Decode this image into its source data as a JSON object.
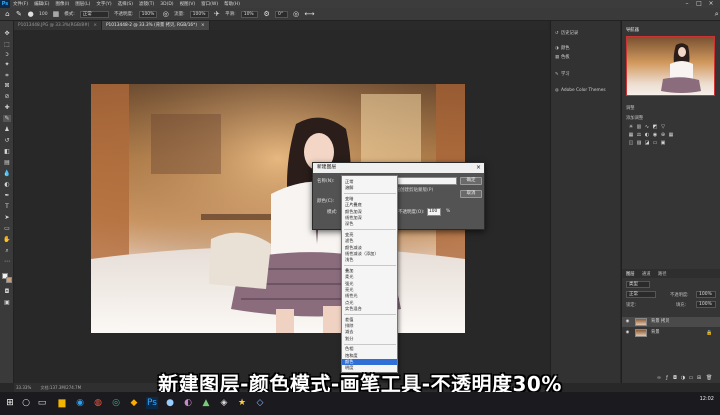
{
  "menubar": {
    "app_logo": "Ps",
    "items": [
      "文件(F)",
      "编辑(E)",
      "图像(I)",
      "图层(L)",
      "文字(Y)",
      "选择(S)",
      "滤镜(T)",
      "3D(D)",
      "视图(V)",
      "窗口(W)",
      "帮助(H)"
    ]
  },
  "optbar": {
    "brush_size": "100",
    "mode_label": "模式:",
    "mode_value": "正常",
    "opacity_label": "不透明度:",
    "opacity_value": "100%",
    "flow_label": "流量:",
    "flow_value": "100%",
    "smoothing_label": "平滑:",
    "smoothing_value": "10%",
    "angle_value": "0°"
  },
  "tabs": [
    {
      "label": "P1013448.JPG @ 33.3%(RGB/8#)",
      "close": "×"
    },
    {
      "label": "P1013448-2 @ 33.3% (背景 拷贝, RGB/16*)",
      "close": "×"
    }
  ],
  "statusbar": {
    "zoom": "33.33%",
    "doc": "文档:137.3M/274.7M"
  },
  "mini_panel": {
    "items": [
      "历史记录",
      "颜色",
      "色板",
      "学习",
      "Adobe Color Themes"
    ],
    "icons": [
      "history-icon",
      "color-icon",
      "swatches-icon",
      "learn-icon",
      "adobe-color-icon"
    ]
  },
  "right_panel": {
    "navigator_tab": "导航器",
    "histogram_tab": "直方图",
    "adjust_tab": "调整",
    "adjust_add": "添加调整",
    "layers_tabs": [
      "图层",
      "通道",
      "路径"
    ],
    "kind": "类型",
    "blend_mode": "正常",
    "opacity_label": "不透明度:",
    "opacity_value": "100%",
    "lock_label": "锁定:",
    "fill_label": "填充:",
    "fill_value": "100%",
    "layers": [
      {
        "name": "背景 拷贝",
        "selected": true
      },
      {
        "name": "背景",
        "selected": false
      }
    ]
  },
  "dialog": {
    "title": "新建图层",
    "name_label": "名称(N):",
    "name_value": "图层 1",
    "clip_label": "使用前一图层创建剪贴蒙版(P)",
    "color_label": "颜色(C):",
    "mode_label": "模式:",
    "opacity_label": "不透明度(O):",
    "opacity_value": "100",
    "percent": "%",
    "ok": "确定",
    "cancel": "取消",
    "close": "×"
  },
  "blend_modes": {
    "groups": [
      [
        "正常",
        "溶解"
      ],
      [
        "变暗",
        "正片叠底",
        "颜色加深",
        "线性加深",
        "深色"
      ],
      [
        "变亮",
        "滤色",
        "颜色减淡",
        "线性减淡（添加）",
        "浅色"
      ],
      [
        "叠加",
        "柔光",
        "强光",
        "亮光",
        "线性光",
        "点光",
        "实色混合"
      ],
      [
        "差值",
        "排除",
        "减去",
        "划分"
      ],
      [
        "色相",
        "饱和度",
        "颜色",
        "明度"
      ]
    ],
    "highlighted": "颜色"
  },
  "subtitle": "新建图层-颜色模式-画笔工具-不透明度30%",
  "taskbar": {
    "time": "12:02",
    "date": ""
  }
}
